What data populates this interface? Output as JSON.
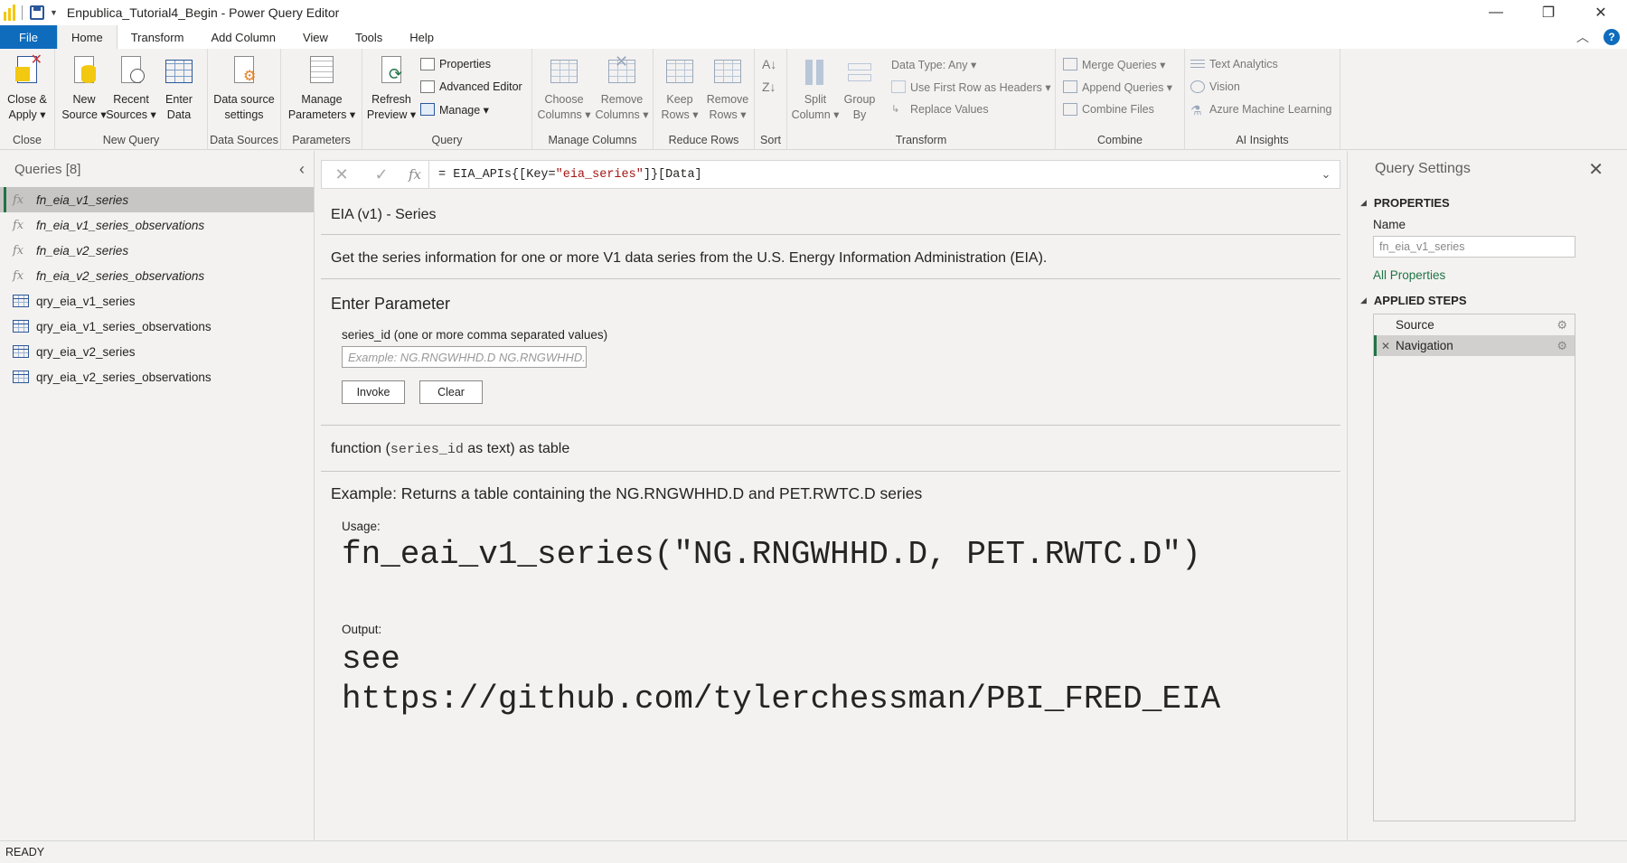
{
  "window": {
    "title": "Enpublica_Tutorial4_Begin - Power Query Editor",
    "minimize": "—",
    "restore": "❐",
    "close": "✕"
  },
  "tabs": [
    {
      "label": "File"
    },
    {
      "label": "Home"
    },
    {
      "label": "Transform"
    },
    {
      "label": "Add Column"
    },
    {
      "label": "View"
    },
    {
      "label": "Tools"
    },
    {
      "label": "Help"
    }
  ],
  "ribbon": {
    "close_group": {
      "label": "Close",
      "close_apply": "Close &",
      "close_apply2": "Apply ▾"
    },
    "new_query_group": {
      "label": "New Query",
      "new_source": "New",
      "new_source2": "Source ▾",
      "recent_sources": "Recent",
      "recent_sources2": "Sources ▾",
      "enter_data": "Enter",
      "enter_data2": "Data"
    },
    "data_sources_group": {
      "label": "Data Sources",
      "ds_settings": "Data source",
      "ds_settings2": "settings"
    },
    "parameters_group": {
      "label": "Parameters",
      "manage_params": "Manage",
      "manage_params2": "Parameters ▾"
    },
    "query_group": {
      "label": "Query",
      "refresh": "Refresh",
      "refresh2": "Preview ▾",
      "properties": "Properties",
      "advanced_editor": "Advanced Editor",
      "manage": "Manage ▾"
    },
    "manage_columns_group": {
      "label": "Manage Columns",
      "choose": "Choose",
      "choose2": "Columns ▾",
      "remove": "Remove",
      "remove2": "Columns ▾"
    },
    "reduce_rows_group": {
      "label": "Reduce Rows",
      "keep": "Keep",
      "keep2": "Rows ▾",
      "remove": "Remove",
      "remove2": "Rows ▾"
    },
    "sort_group": {
      "label": "Sort"
    },
    "transform_group": {
      "label": "Transform",
      "split": "Split",
      "split2": "Column ▾",
      "group_by": "Group",
      "group_by2": "By",
      "data_type": "Data Type: Any ▾",
      "first_row": "Use First Row as Headers ▾",
      "replace": "Replace Values"
    },
    "combine_group": {
      "label": "Combine",
      "merge": "Merge Queries ▾",
      "append": "Append Queries ▾",
      "combine_files": "Combine Files"
    },
    "ai_group": {
      "label": "AI Insights",
      "text_analytics": "Text Analytics",
      "vision": "Vision",
      "azure_ml": "Azure Machine Learning"
    }
  },
  "queries": {
    "header": "Queries [8]",
    "items": [
      {
        "name": "fn_eia_v1_series",
        "type": "function"
      },
      {
        "name": "fn_eia_v1_series_observations",
        "type": "function"
      },
      {
        "name": "fn_eia_v2_series",
        "type": "function"
      },
      {
        "name": "fn_eia_v2_series_observations",
        "type": "function"
      },
      {
        "name": "qry_eia_v1_series",
        "type": "table"
      },
      {
        "name": "qry_eia_v1_series_observations",
        "type": "table"
      },
      {
        "name": "qry_eia_v2_series",
        "type": "table"
      },
      {
        "name": "qry_eia_v2_series_observations",
        "type": "table"
      }
    ]
  },
  "formula": {
    "prefix": "= EIA_APIs{[Key=",
    "string": "\"eia_series\"",
    "suffix": "]}[Data]"
  },
  "function_pane": {
    "title": "EIA (v1) - Series",
    "description": "Get the series information for one or more V1 data series from the U.S. Energy Information Administration (EIA).",
    "enter_parameter": "Enter Parameter",
    "param_label": "series_id (one or more comma separated values)",
    "param_placeholder": "Example: NG.RNGWHHD.D   NG.RNGWHHD.D",
    "invoke": "Invoke",
    "clear": "Clear",
    "sig_prefix": "function (",
    "sig_param": "series_id",
    "sig_suffix": " as text) as table",
    "example_title": "Example: Returns a table containing the NG.RNGWHHD.D and PET.RWTC.D series",
    "usage_label": "Usage:",
    "usage_code": "fn_eai_v1_series(\"NG.RNGWHHD.D, PET.RWTC.D\")",
    "output_label": "Output:",
    "output_line1": "see",
    "output_line2": "https://github.com/tylerchessman/PBI_FRED_EIA"
  },
  "query_settings": {
    "title": "Query Settings",
    "properties": "PROPERTIES",
    "name_label": "Name",
    "name_value": "fn_eia_v1_series",
    "all_properties": "All Properties",
    "applied_steps": "APPLIED STEPS",
    "steps": [
      {
        "name": "Source"
      },
      {
        "name": "Navigation"
      }
    ]
  },
  "status": {
    "text": "READY"
  },
  "colors": {
    "accent": "#0f6cbd",
    "selection_bar": "#217346",
    "link": "#217346"
  }
}
